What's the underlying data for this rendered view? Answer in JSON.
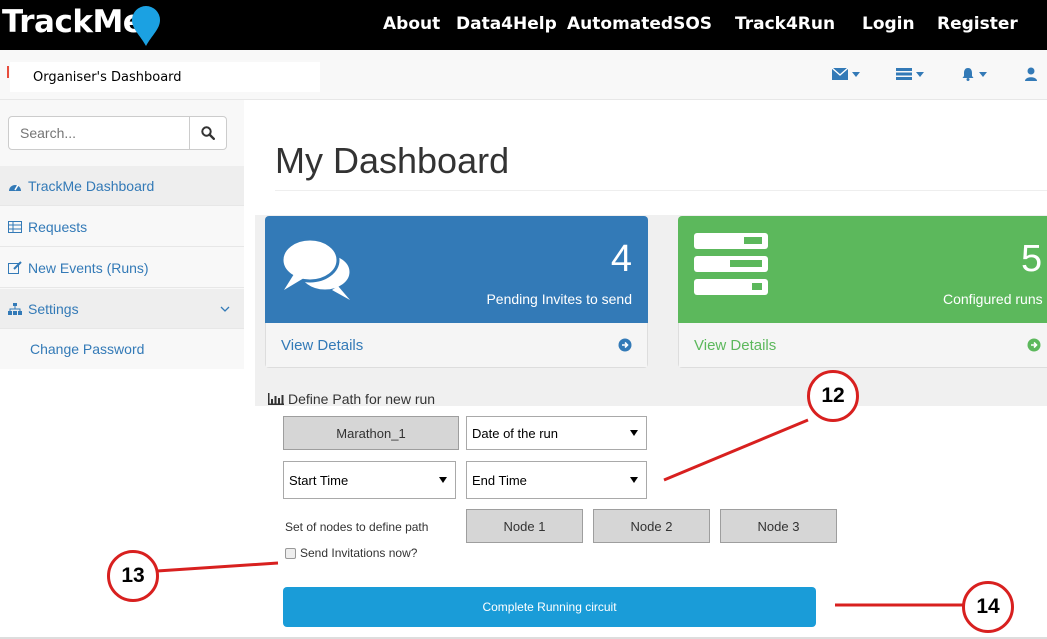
{
  "navbar": {
    "brand": "TrackMe",
    "links": [
      "About",
      "Data4Help",
      "AutomatedSOS",
      "Track4Run",
      "Login",
      "Register"
    ]
  },
  "subbar": {
    "title": "Organiser's Dashboard",
    "icons": [
      "envelope-icon",
      "tasks-icon",
      "bell-icon",
      "user-icon"
    ]
  },
  "sidebar": {
    "search_placeholder": "Search...",
    "items": [
      {
        "label": "TrackMe Dashboard",
        "icon": "dashboard-icon"
      },
      {
        "label": "Requests",
        "icon": "table-icon"
      },
      {
        "label": "New Events (Runs)",
        "icon": "edit-icon"
      },
      {
        "label": "Settings",
        "icon": "sitemap-icon"
      },
      {
        "label": "Change Password"
      }
    ]
  },
  "main": {
    "title": "My Dashboard",
    "panels": [
      {
        "count": "4",
        "label": "Pending Invites to send",
        "footer": "View Details",
        "color": "#337ab7"
      },
      {
        "count": "5",
        "label": "Configured runs",
        "footer": "View Details",
        "color": "#5cb85c"
      }
    ],
    "form": {
      "heading": "Define Path for new run",
      "run_name": "Marathon_1",
      "date_select": "Date of the run",
      "start_select": "Start Time",
      "end_select": "End Time",
      "nodes_label": "Set of nodes to define path",
      "nodes": [
        "Node 1",
        "Node 2",
        "Node 3"
      ],
      "checkbox_label": "Send Invitations now?",
      "submit": "Complete Running circuit"
    }
  },
  "annotations": [
    "12",
    "13",
    "14"
  ],
  "colors": {
    "primary": "#337ab7",
    "success": "#5cb85c",
    "info": "#1a9cd8",
    "annotation": "#d8201f"
  }
}
